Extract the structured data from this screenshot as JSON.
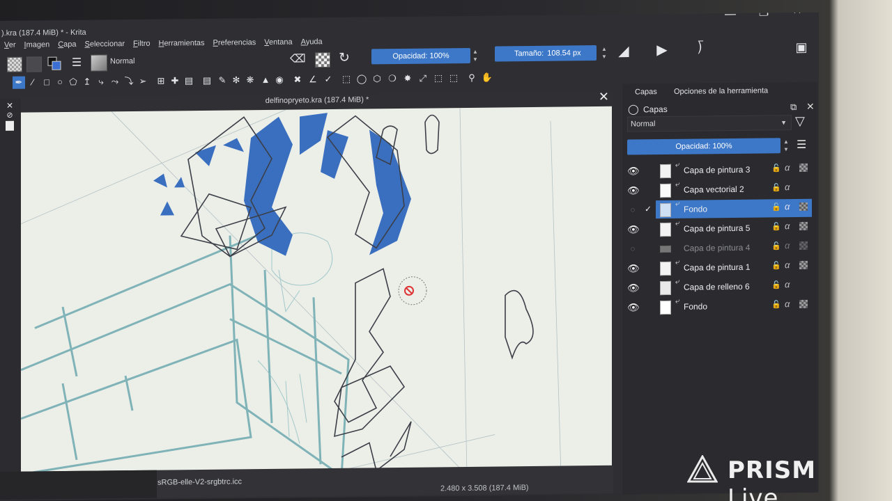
{
  "app": {
    "title": ").kra (187.4 MiB) * - Krita",
    "menu": [
      "Ver",
      "Imagen",
      "Capa",
      "Seleccionar",
      "Filtro",
      "Herramientas",
      "Preferencias",
      "Ventana",
      "Ayuda"
    ]
  },
  "brush_toolbar": {
    "blend_mode": "Normal",
    "opacity_label": "Opacidad: 100%",
    "size_label": "Tamaño:",
    "size_value": "108.54 px"
  },
  "document": {
    "title": "delfinopryeto.kra (187.4 MiB) *",
    "color_profile": "sRGB-elle-V2-srgbtrc.icc",
    "size_text": "2.480 x 3.508 (187.4 MiB)"
  },
  "docker": {
    "tabs": [
      "Capas",
      "Opciones de la herramienta"
    ],
    "title": "Capas",
    "blend_mode": "Normal",
    "opacity_label": "Opacidad: 100%",
    "layers": [
      {
        "name": "Capa de pintura 3",
        "visible": true,
        "selected": false,
        "dim": false
      },
      {
        "name": "Capa vectorial 2",
        "visible": true,
        "selected": false,
        "dim": false
      },
      {
        "name": "Fondo",
        "visible": false,
        "selected": true,
        "dim": false
      },
      {
        "name": "Capa de pintura 5",
        "visible": true,
        "selected": false,
        "dim": false
      },
      {
        "name": "Capa de pintura 4",
        "visible": false,
        "selected": false,
        "dim": true
      },
      {
        "name": "Capa de pintura 1",
        "visible": true,
        "selected": false,
        "dim": false
      },
      {
        "name": "Capa de relleno 6",
        "visible": true,
        "selected": false,
        "dim": false
      },
      {
        "name": "Fondo",
        "visible": true,
        "selected": false,
        "dim": false
      }
    ]
  },
  "watermark": {
    "brand": "PRISM",
    "suffix": "Live"
  },
  "colors": {
    "accent": "#3d78c8",
    "ink_blue": "#3a6fc0",
    "sketch_teal": "#7fb3b8",
    "canvas": "#eceee8"
  }
}
